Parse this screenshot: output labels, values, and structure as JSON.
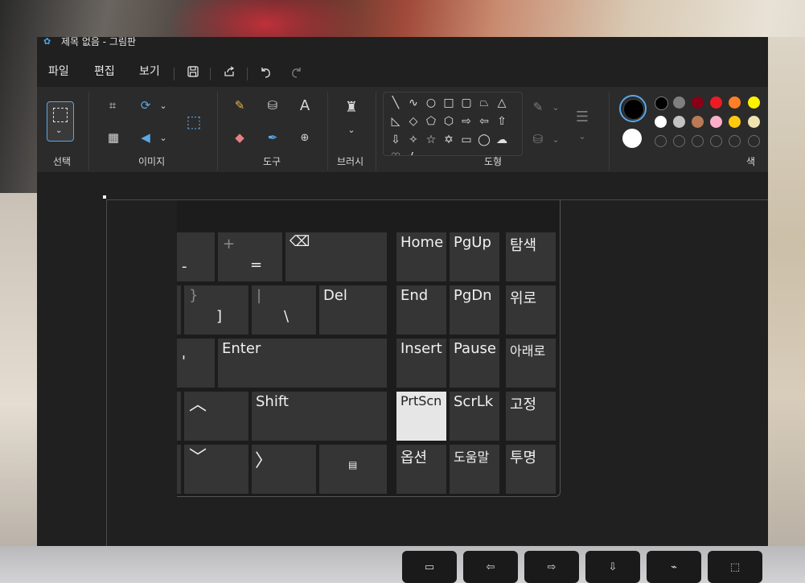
{
  "window": {
    "title": "제목 없음 - 그림판"
  },
  "menu": {
    "file": "파일",
    "edit": "편집",
    "view": "보기"
  },
  "ribbon": {
    "groups": {
      "select": "선택",
      "image": "이미지",
      "tools": "도구",
      "brush": "브러시",
      "shapes": "도형",
      "colors": "색"
    },
    "colors": {
      "primary": "#000000",
      "secondary": "#ffffff",
      "row1": [
        "#000000",
        "#7f7f7f",
        "#880015",
        "#ed1c24",
        "#ff7f27",
        "#fff200"
      ],
      "row2": [
        "#ffffff",
        "#c3c3c3",
        "#b97a57",
        "#ffaec9",
        "#ffc90e",
        "#efe4b0"
      ]
    }
  },
  "keyboard": {
    "keys": {
      "minus_top": "",
      "minus": "-",
      "plus": "+",
      "equals": "=",
      "backspace": "⌫",
      "brace": "}",
      "bracket": "]",
      "pipe": "|",
      "backslash": "\\",
      "del": "Del",
      "home": "Home",
      "pgup": "PgUp",
      "search": "탐색",
      "end": "End",
      "pgdn": "PgDn",
      "up_label": "위로",
      "apostrophe": "'",
      "enter": "Enter",
      "insert": "Insert",
      "pause": "Pause",
      "down_label": "아래로",
      "arrow_up": "︿",
      "shift": "Shift",
      "prtscn": "PrtScn",
      "scrlk": "ScrLk",
      "pin": "고정",
      "arrow_down": "﹀",
      "arrow_right": "〉",
      "menu_key": "▤",
      "options": "옵션",
      "help": "도움말",
      "transparency": "투명"
    }
  }
}
